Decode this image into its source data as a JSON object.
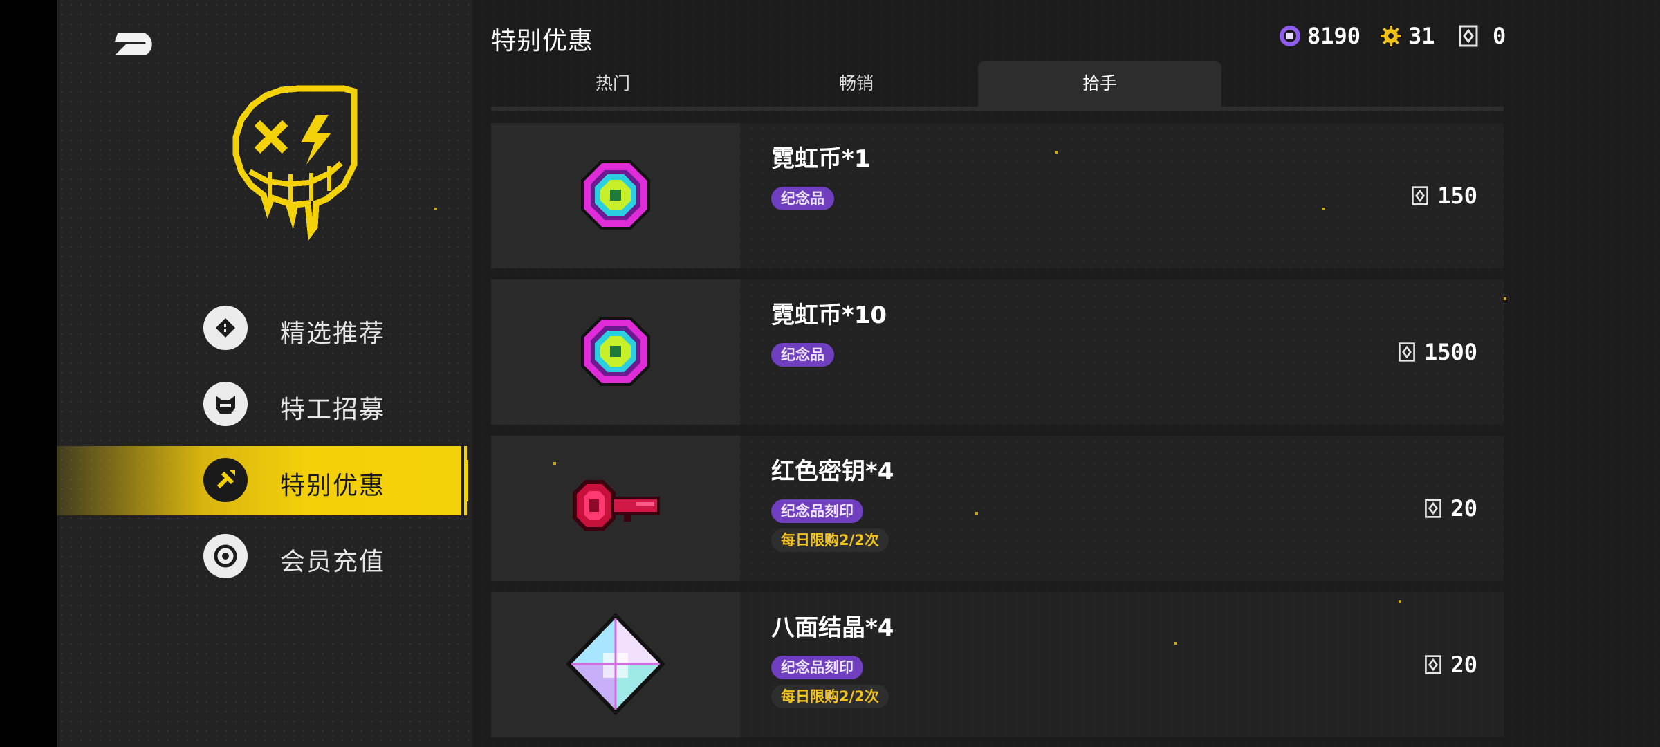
{
  "header": {
    "title": "特别优惠",
    "currencies": [
      {
        "icon": "purple-coin-icon",
        "value": "8190",
        "color": "#8f5cf0"
      },
      {
        "icon": "gold-gear-icon",
        "value": "31",
        "color": "#f1c21b"
      },
      {
        "icon": "ticket-icon",
        "value": "0",
        "color": "#e6e6e6"
      }
    ]
  },
  "sidebar": {
    "back_icon": "back-arrow-icon",
    "logo_icon": "yellow-smiley-logo",
    "items": [
      {
        "label": "精选推荐",
        "icon": "ticket-tag-icon",
        "active": false
      },
      {
        "label": "特工招募",
        "icon": "cat-mask-icon",
        "active": false
      },
      {
        "label": "特别优惠",
        "icon": "wrench-bolt-icon",
        "active": true
      },
      {
        "label": "会员充值",
        "icon": "target-ring-icon",
        "active": false
      }
    ]
  },
  "tabs": [
    {
      "label": "热门",
      "selected": false
    },
    {
      "label": "畅销",
      "selected": false
    },
    {
      "label": "拾手",
      "selected": true
    }
  ],
  "items": [
    {
      "name": "霓虹币*1",
      "badge": "纪念品",
      "limit": "",
      "price": "150",
      "icon": "neon-coin-icon"
    },
    {
      "name": "霓虹币*10",
      "badge": "纪念品",
      "limit": "",
      "price": "1500",
      "icon": "neon-coin-icon"
    },
    {
      "name": "红色密钥*4",
      "badge": "纪念品刻印",
      "limit": "每日限购2/2次",
      "price": "20",
      "icon": "red-key-icon"
    },
    {
      "name": "八面结晶*4",
      "badge": "纪念品刻印",
      "limit": "每日限购2/2次",
      "price": "20",
      "icon": "octahedron-crystal-icon"
    }
  ],
  "colors": {
    "accent": "#f4d20a",
    "badge": "#6f3fc0",
    "limit_text": "#f1c21b"
  }
}
